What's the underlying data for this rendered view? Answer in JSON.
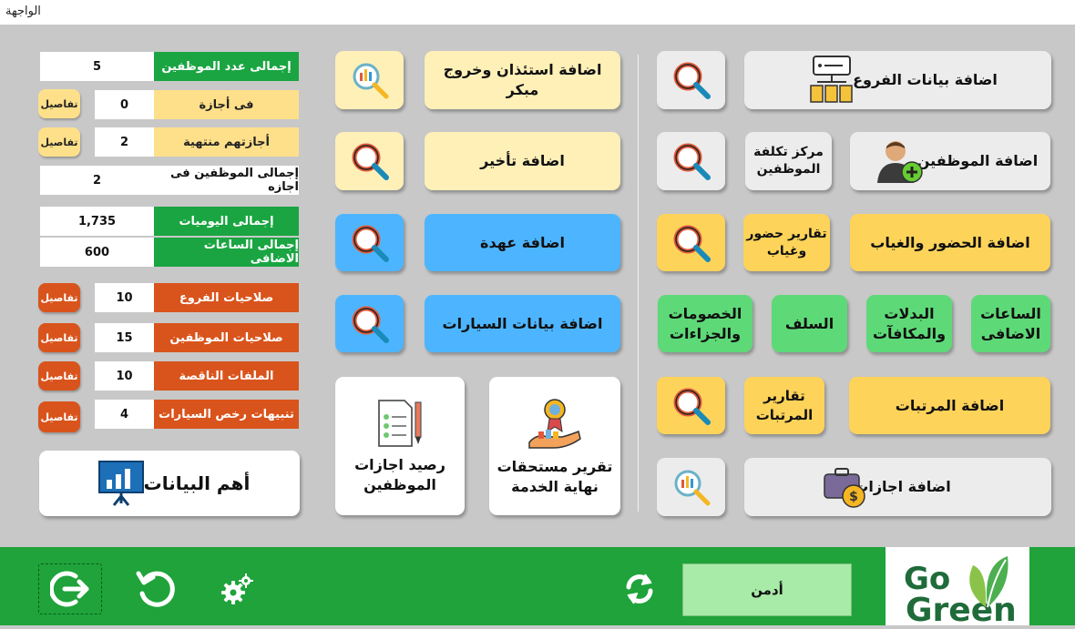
{
  "window": {
    "title": "الواجهة"
  },
  "right_panel": {
    "branches_btn": "اضافة بيانات الفروع",
    "employees_btn": "اضافة الموظفين",
    "cost_center_btn": "مركز تكلفة\nالموظفين",
    "attendance_btn": "اضافة الحضور والغياب",
    "attendance_reports_btn": "تقارير حضور\nوغياب",
    "overtime_btn": "الساعات\nالاضافى",
    "allowances_btn": "البدلات\nوالمكافآت",
    "loans_btn": "السلف",
    "deductions_btn": "الخصومات\nوالجزاءات",
    "salaries_btn": "اضافة المرتبات",
    "salary_reports_btn": "تقارير\nالمرتبات",
    "vacations_btn": "اضافة اجازات"
  },
  "middle_panel": {
    "permission_btn": "اضافة استئذان وخروج مبكر",
    "delay_btn": "اضافة تأخير",
    "custody_btn": "اضافة عهدة",
    "cars_btn": "اضافة بيانات السيارات",
    "end_of_service_btn": "تقرير مستحقات\nنهاية الخدمة",
    "vacation_balance_btn": "رصيد اجازات\nالموظفين"
  },
  "stats": {
    "total_employees": {
      "label": "إجمالى عدد الموظفين",
      "value": "5"
    },
    "on_leave": {
      "label": "فى أجازة",
      "value": "0",
      "details": "تفاصيل"
    },
    "leave_ended": {
      "label": "أجازتهم منتهية",
      "value": "2",
      "details": "تفاصيل"
    },
    "total_on_leave": {
      "label": "إجمالى الموظفين فى اجازه",
      "value": "2"
    },
    "total_daily": {
      "label": "إجمالى اليوميات",
      "value": "1,735"
    },
    "total_overtime": {
      "label": "إجمالى الساعات الاضافى",
      "value": "600"
    },
    "branch_permissions": {
      "label": "صلاحيات الفروع",
      "value": "10",
      "details": "تفاصيل"
    },
    "employee_permissions": {
      "label": "صلاحيات الموظفين",
      "value": "15",
      "details": "تفاصيل"
    },
    "missing_files": {
      "label": "الملفات الناقصة",
      "value": "10",
      "details": "تفاصيل"
    },
    "car_license_alerts": {
      "label": "تنبيهات رخص السيارات",
      "value": "4",
      "details": "تفاصيل"
    }
  },
  "key_data_btn": "أهم البيانات",
  "footer": {
    "user": "أدمن",
    "logo_line1": "Go",
    "logo_line2": "Green"
  },
  "colors": {
    "green": "#1aa542",
    "yellow": "#fdd35a",
    "blue": "#4db5ff",
    "orange": "#d9541c"
  },
  "icons": [
    "magnifier-icon",
    "chart-magnifier-icon",
    "branches-icon",
    "add-user-icon",
    "briefcase-money-icon",
    "award-hand-icon",
    "checklist-icon",
    "presentation-icon",
    "logout-icon",
    "refresh-icon",
    "settings-icon",
    "sync-icon",
    "leaf-icon"
  ]
}
